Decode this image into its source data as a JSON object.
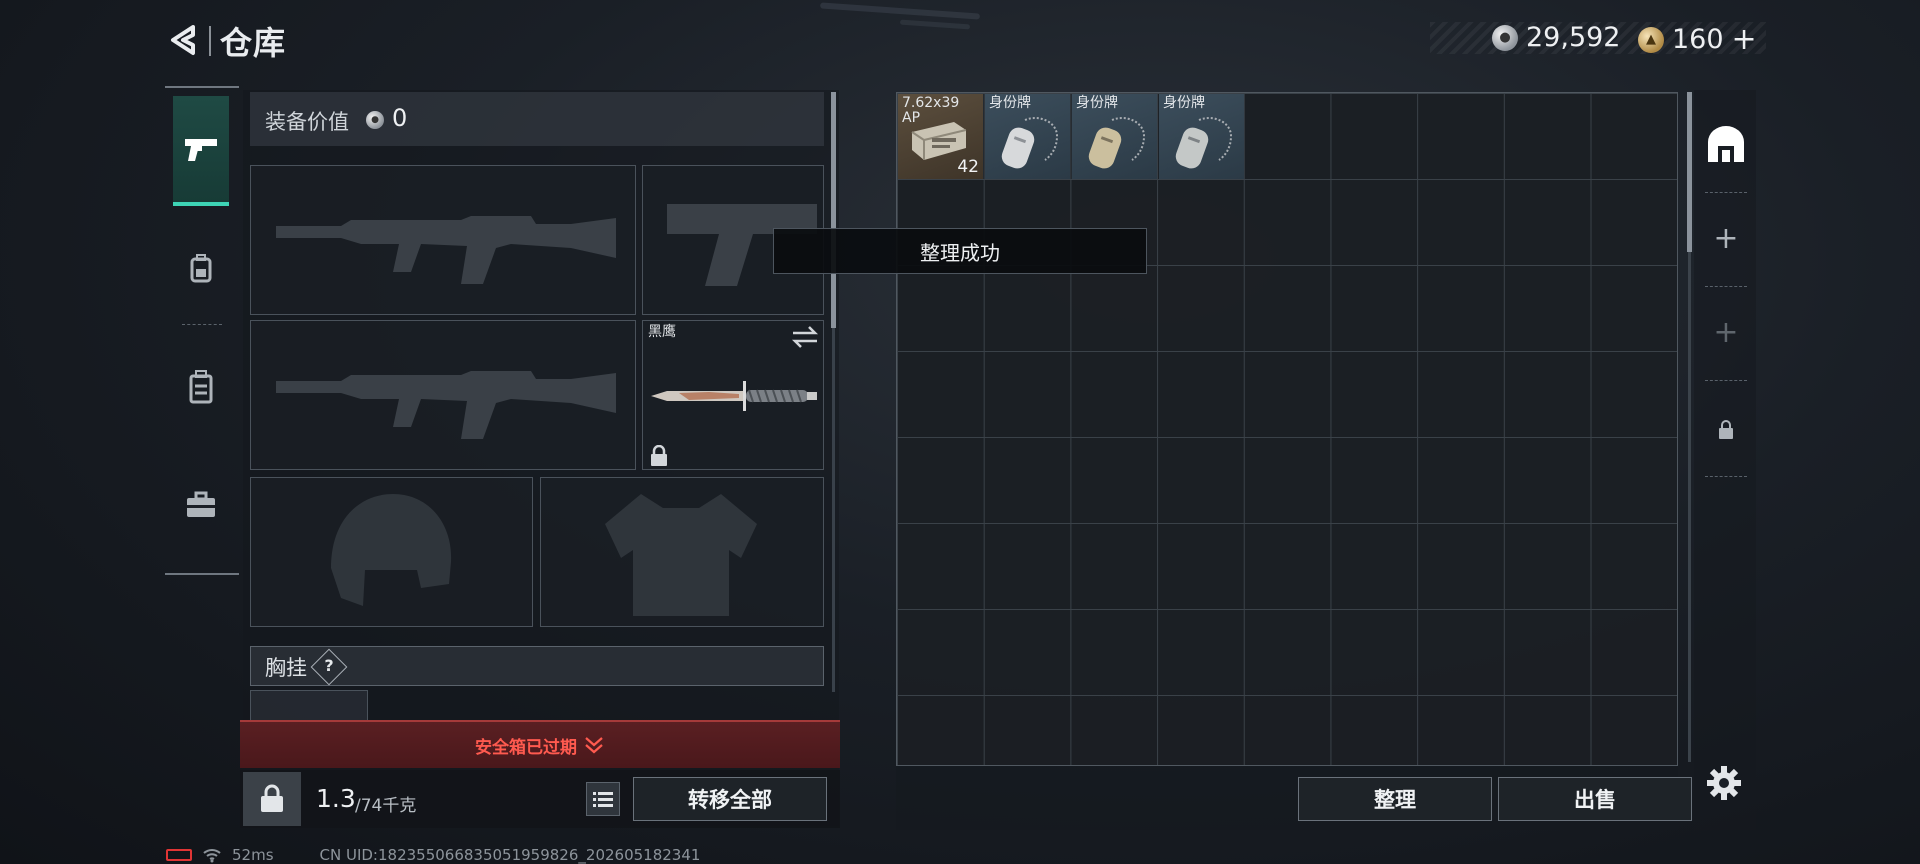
{
  "header": {
    "title": "仓库",
    "currency": [
      {
        "icon": "silver-coin-icon",
        "value": "29,592"
      },
      {
        "icon": "gold-coin-icon",
        "value": "160",
        "add_label": "+"
      }
    ]
  },
  "tabs": [
    {
      "name": "weapon-tab",
      "icon": "pistol-icon",
      "active": true
    },
    {
      "name": "gear-tab",
      "icon": "backpack-icon",
      "active": false
    },
    {
      "name": "vest-tab",
      "icon": "rig-icon",
      "active": false
    },
    {
      "name": "case-tab",
      "icon": "briefcase-icon",
      "active": false
    }
  ],
  "equipment": {
    "value_label": "装备价值",
    "value": "0",
    "knife_label": "黑鹰",
    "chest_label": "胸挂",
    "chest_help": "?"
  },
  "alert": {
    "text": "安全箱已过期",
    "icon": "chevron-down-icon"
  },
  "bottom": {
    "weight_current": "1.3",
    "weight_max": "/74千克",
    "transfer_all": "转移全部"
  },
  "toast": "整理成功",
  "storage": {
    "items": [
      {
        "type": "ammo",
        "label": "7.62x39 AP",
        "qty": "42"
      },
      {
        "type": "tag",
        "label": "身份牌"
      },
      {
        "type": "tag",
        "label": "身份牌"
      },
      {
        "type": "tag",
        "label": "身份牌"
      }
    ],
    "sort_label": "整理",
    "sell_label": "出售"
  },
  "side_rail": [
    {
      "icon": "storage-icon"
    },
    {
      "icon": "plus-icon",
      "label": "+"
    },
    {
      "icon": "plus-icon",
      "label": "+"
    },
    {
      "icon": "lock-icon"
    }
  ],
  "status_bar": {
    "ping": "52ms",
    "uid": "CN UID:1823550668350519598​26_202605182341"
  },
  "colors": {
    "accent": "#3dd4b5",
    "alert": "#ff5a4f",
    "ammo_bg": "#5c4f3e",
    "tag_bg": "#3c4e5c"
  }
}
